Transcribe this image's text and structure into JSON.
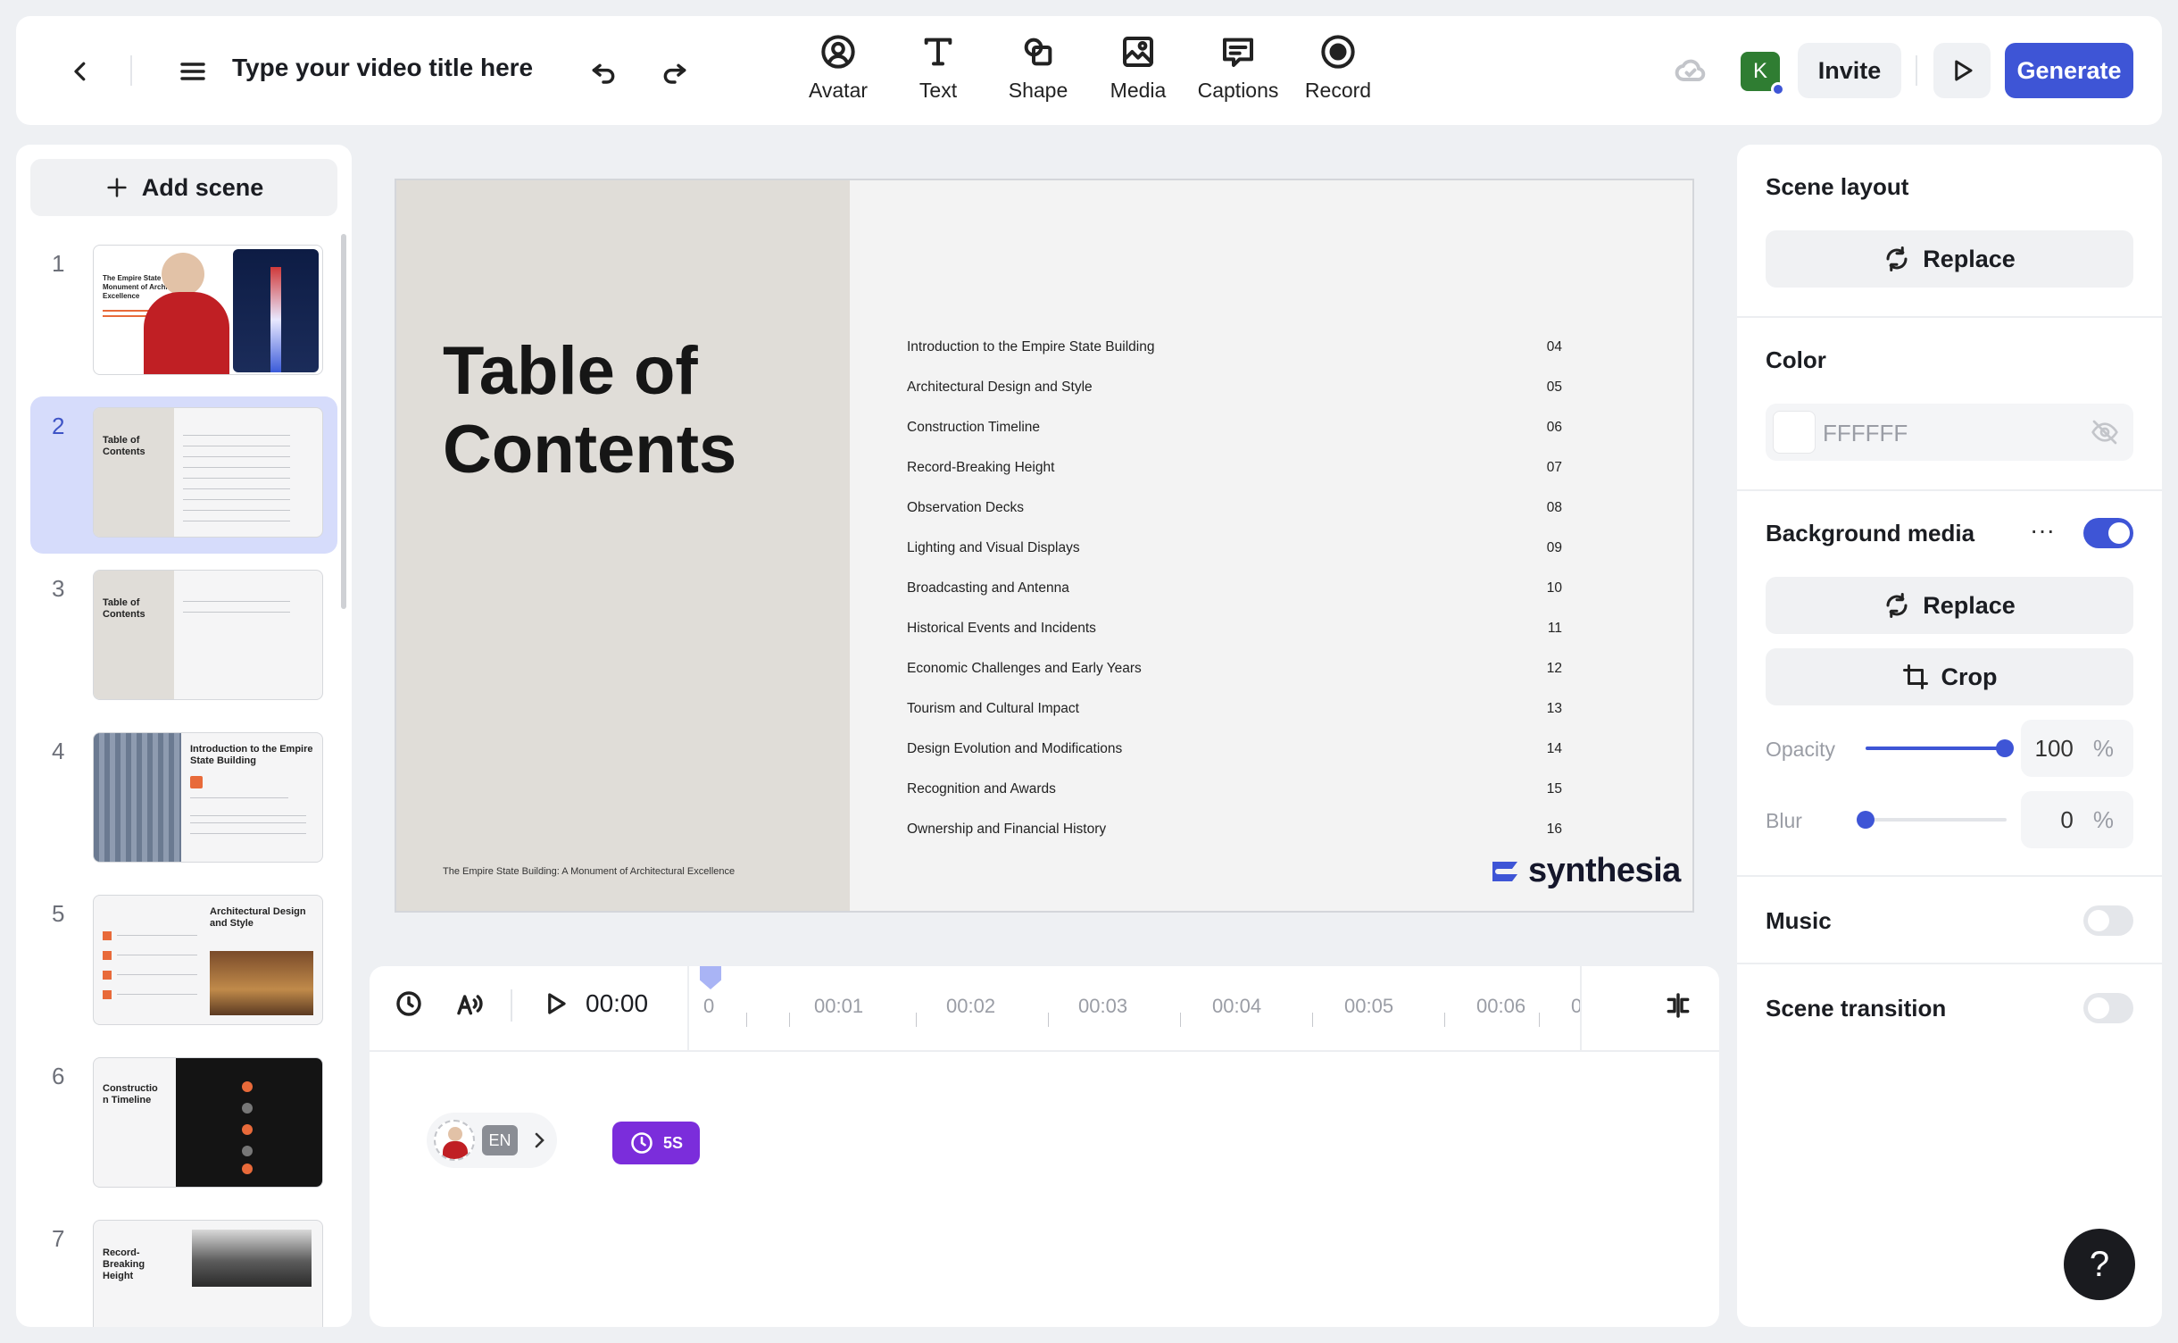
{
  "topbar": {
    "video_title": "Type your video title here",
    "tools": [
      {
        "label": "Avatar",
        "icon": "avatar-icon"
      },
      {
        "label": "Text",
        "icon": "text-icon"
      },
      {
        "label": "Shape",
        "icon": "shape-icon"
      },
      {
        "label": "Media",
        "icon": "media-icon"
      },
      {
        "label": "Captions",
        "icon": "captions-icon"
      },
      {
        "label": "Record",
        "icon": "record-icon"
      }
    ],
    "user_initial": "K",
    "invite_label": "Invite",
    "generate_label": "Generate",
    "accent_color": "#3e55d6"
  },
  "scenes": {
    "add_label": "Add scene",
    "items": [
      {
        "num": "1",
        "title": "The Empire State Building: Monument of Architectural Excellence"
      },
      {
        "num": "2",
        "title": "Table of Contents",
        "selected": true
      },
      {
        "num": "3",
        "title": "Table of Contents"
      },
      {
        "num": "4",
        "title": "Introduction to the Empire State Building"
      },
      {
        "num": "5",
        "title": "Architectural Design and Style"
      },
      {
        "num": "6",
        "title": "Constructio n Timeline"
      },
      {
        "num": "7",
        "title": "Record- Breaking Height"
      }
    ]
  },
  "canvas": {
    "title_line1": "Table of",
    "title_line2": "Contents",
    "footer": "The Empire State Building: A Monument of Architectural Excellence",
    "logo_text": "synthesia",
    "toc": [
      {
        "text": "Introduction to the Empire State Building",
        "page": "04"
      },
      {
        "text": "Architectural Design and Style",
        "page": "05"
      },
      {
        "text": "Construction Timeline",
        "page": "06"
      },
      {
        "text": "Record-Breaking Height",
        "page": "07"
      },
      {
        "text": "Observation Decks",
        "page": "08"
      },
      {
        "text": "Lighting and Visual Displays",
        "page": "09"
      },
      {
        "text": "Broadcasting and Antenna",
        "page": "10"
      },
      {
        "text": "Historical Events and Incidents",
        "page": "11"
      },
      {
        "text": "Economic Challenges and Early Years",
        "page": "12"
      },
      {
        "text": "Tourism and Cultural Impact",
        "page": "13"
      },
      {
        "text": "Design Evolution and Modifications",
        "page": "14"
      },
      {
        "text": "Recognition and Awards",
        "page": "15"
      },
      {
        "text": "Ownership and Financial History",
        "page": "16"
      }
    ]
  },
  "timeline": {
    "current_time": "00:00",
    "marks": [
      "0",
      "00:01",
      "00:02",
      "00:03",
      "00:04",
      "00:05",
      "00:06",
      "0"
    ],
    "language": "EN",
    "duration_badge": "5S"
  },
  "properties": {
    "scene_layout": {
      "title": "Scene layout",
      "button": "Replace"
    },
    "color": {
      "title": "Color",
      "value": "FFFFFF"
    },
    "background_media": {
      "title": "Background media",
      "enabled": true,
      "replace_label": "Replace",
      "crop_label": "Crop",
      "opacity_label": "Opacity",
      "opacity_value": "100",
      "blur_label": "Blur",
      "blur_value": "0",
      "unit": "%"
    },
    "music": {
      "title": "Music",
      "enabled": false
    },
    "scene_transition": {
      "title": "Scene transition",
      "enabled": false
    }
  },
  "help_label": "?"
}
